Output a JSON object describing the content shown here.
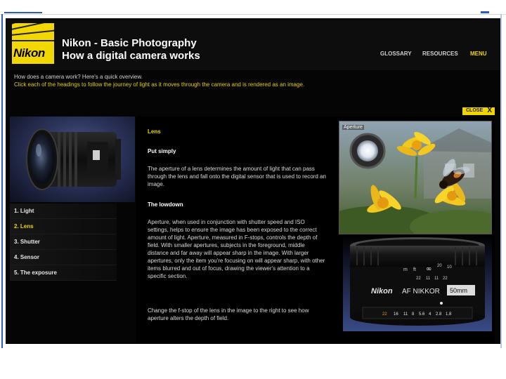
{
  "header": {
    "logo_text": "Nikon",
    "title": "Nikon - Basic Photography",
    "subtitle": "How a digital camera works"
  },
  "nav": {
    "glossary": "GLOSSARY",
    "resources": "RESOURCES",
    "menu": "MENU"
  },
  "intro": {
    "question": "How does a camera work? Here's a quick overview.",
    "instruction": "Click each of the headings to follow the journey of light as it moves through the camera and is rendered as an image."
  },
  "close": {
    "label": "CLOSE",
    "icon": "X"
  },
  "steps": [
    {
      "label": "1. Light"
    },
    {
      "label": "2. Lens"
    },
    {
      "label": "3. Shutter"
    },
    {
      "label": "4. Sensor"
    },
    {
      "label": "5. The exposure"
    }
  ],
  "active_step_index": 1,
  "content": {
    "heading": "Lens",
    "put_simply_heading": "Put simply",
    "put_simply_text": "The aperture of a lens determines the amount of light that can pass through the lens and fall onto the digital sensor that is used to record an image.",
    "lowdown_heading": "The lowdown",
    "lowdown_text": "Aperture, when used in conjunction with shutter speed and ISO settings, helps to ensure the image has been exposed to the correct amount of light. Aperture, measured in F-stops, controls the depth of field. With smaller apertures, subjects in the foreground, middle distance and far away will appear sharp in the image. With larger apertures, only the item you're focusing on will appear sharp, with other items blurred and out of focus, drawing the viewer's attention to a specific section.",
    "change_text": "Change the f-stop of the lens in the image to the right to see how aperture alters the depth of field.",
    "aperture_label": "Aperture"
  },
  "lens_markings": {
    "brand": "Nikon",
    "af_text": "AF NIKKOR",
    "focal_length": "50mm",
    "aperture_scale": [
      "22",
      "16",
      "11",
      "8",
      "5.6",
      "4",
      "2.8",
      "1.8"
    ],
    "distance_scale_top": [
      "m",
      "ft",
      "∞",
      "20",
      "10"
    ],
    "distance_scale_mid": [
      "22",
      "11",
      "11",
      "22"
    ]
  },
  "colors": {
    "accent_yellow": "#f0d400",
    "background": "#050505",
    "text": "#dcdcdc"
  }
}
